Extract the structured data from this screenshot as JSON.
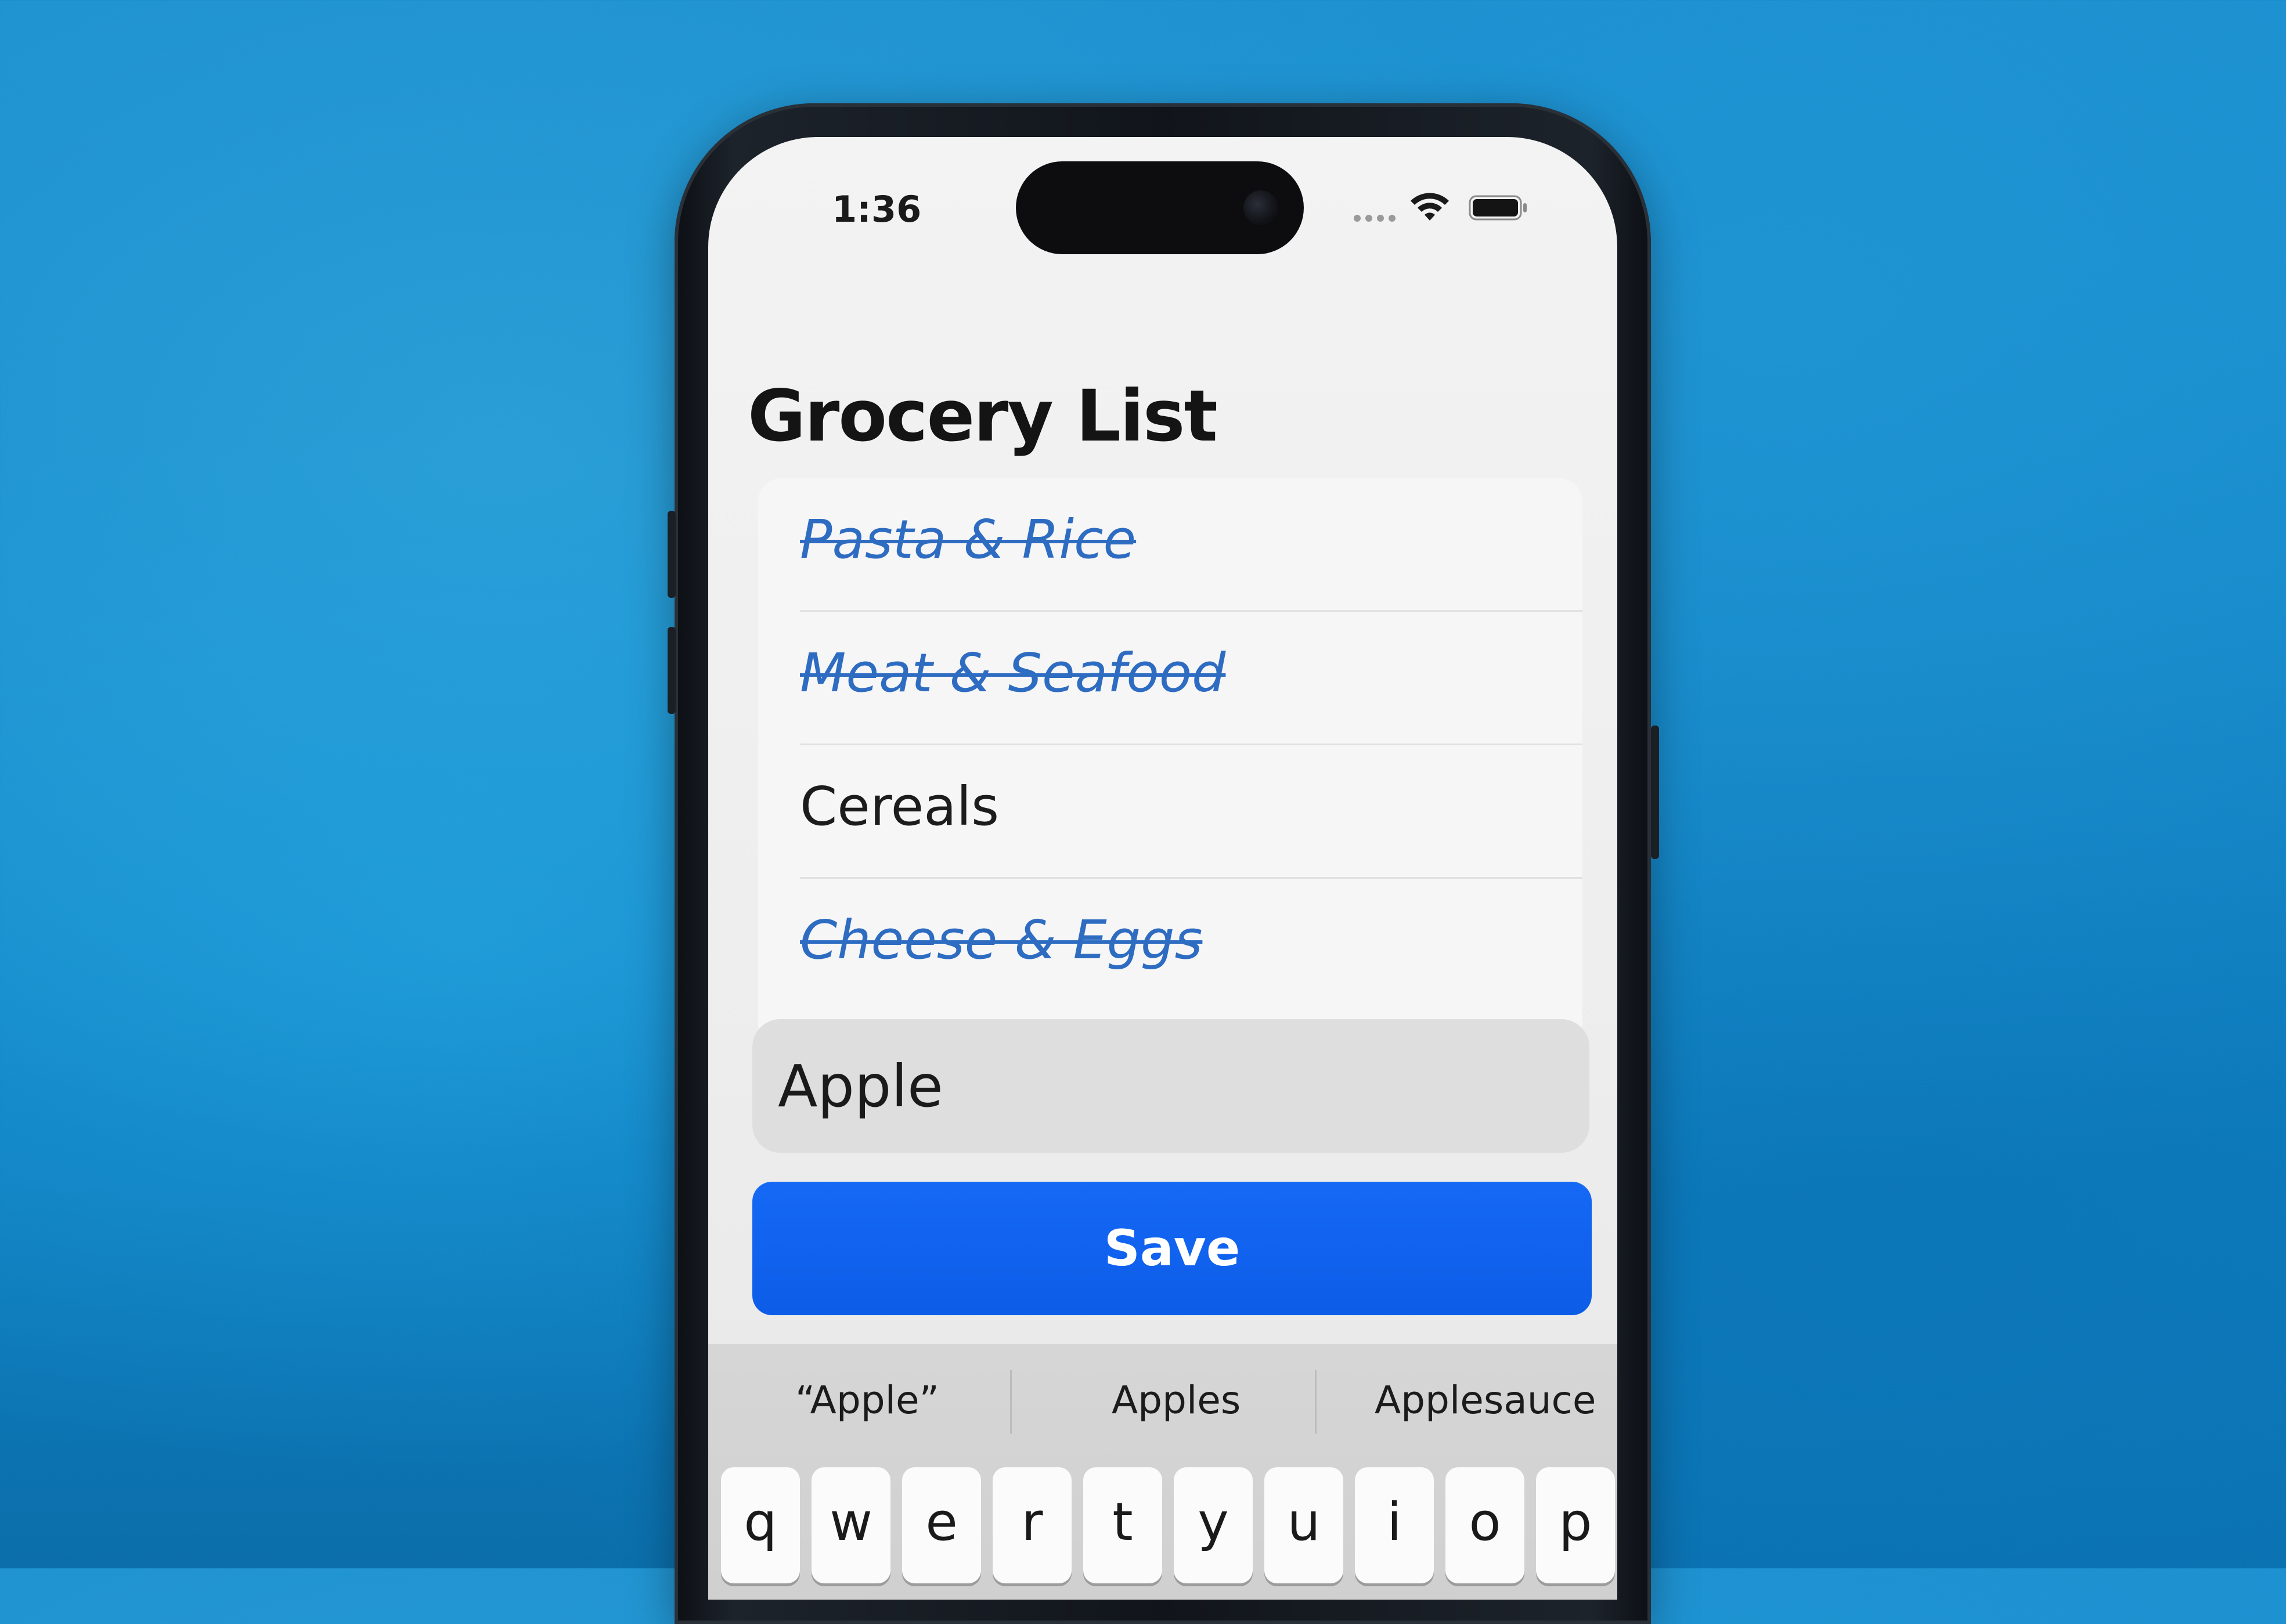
{
  "status_bar": {
    "time": "1:36",
    "icons": [
      "cellular-signal-icon",
      "wifi-icon",
      "battery-icon"
    ]
  },
  "screen": {
    "title": "Grocery List",
    "items": [
      {
        "label": "Pasta & Rice",
        "completed": true
      },
      {
        "label": "Meat & Seafood",
        "completed": true
      },
      {
        "label": "Cereals",
        "completed": false
      },
      {
        "label": "Cheese & Eggs",
        "completed": true
      }
    ],
    "input": {
      "value": "Apple"
    },
    "save_label": "Save"
  },
  "keyboard": {
    "suggestions": [
      "“Apple”",
      "Apples",
      "Applesauce"
    ],
    "row1": [
      "q",
      "w",
      "e",
      "r",
      "t",
      "y",
      "u",
      "i",
      "o",
      "p"
    ]
  },
  "colors": {
    "accent": "#0d5ce8",
    "completed_text": "#2e6cc2",
    "background": "#168ccc"
  }
}
